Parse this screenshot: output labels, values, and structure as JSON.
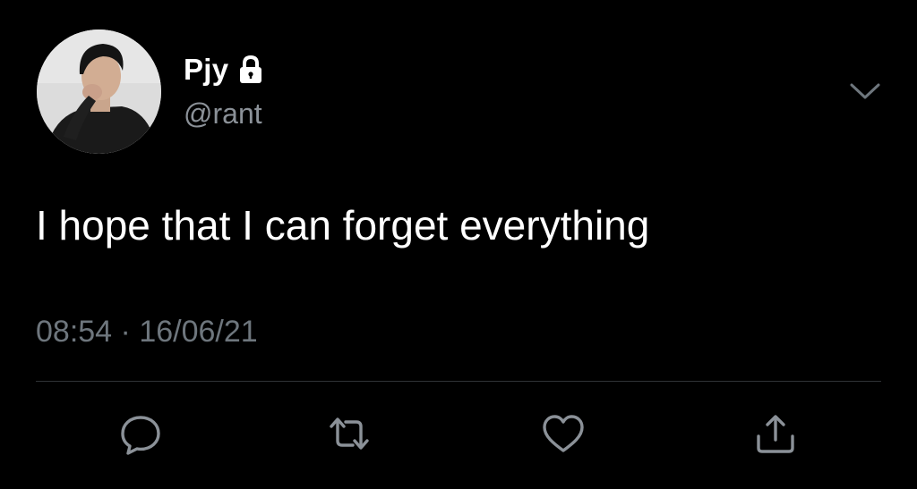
{
  "tweet": {
    "author": {
      "display_name": "Pjy",
      "handle": "@rant",
      "avatar_icon": "profile-photo",
      "protected_icon": "lock-icon"
    },
    "text": "I hope that I can forget everything",
    "time": "08:54",
    "separator": "·",
    "date": "16/06/21"
  },
  "actions": [
    {
      "name": "reply",
      "icon": "speech-bubble-icon"
    },
    {
      "name": "retweet",
      "icon": "retweet-arrows-icon"
    },
    {
      "name": "like",
      "icon": "heart-icon"
    },
    {
      "name": "share",
      "icon": "share-upload-icon"
    }
  ],
  "menu": {
    "icon": "chevron-down-icon"
  },
  "colors": {
    "background": "#000000",
    "text_primary": "#ffffff",
    "text_secondary": "#8b9198",
    "icon_gray": "#8b9198",
    "divider": "#2f3336"
  }
}
